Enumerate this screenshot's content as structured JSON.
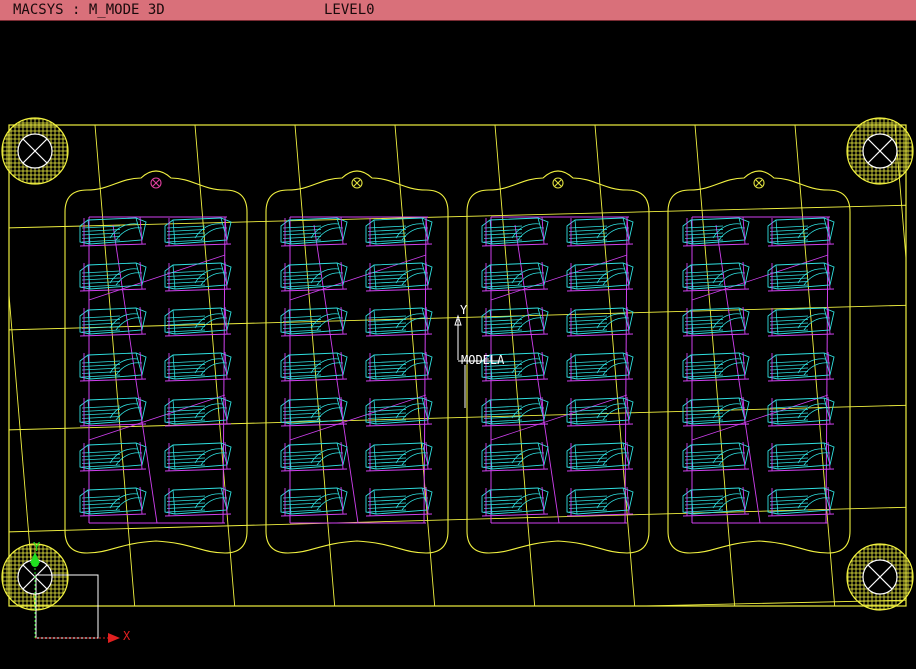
{
  "title_bar": {
    "app_mode": "MACSYS : M_MODE 3D",
    "level": "LEVEL0"
  },
  "viewport": {
    "model_axis": {
      "y_label": "Y",
      "name_label": "MODELA"
    },
    "world_axis": {
      "x_label": "X",
      "y_label": "Y"
    },
    "mold_plate": {
      "cavity_panels": 4,
      "parts_per_panel_rows": 7,
      "parts_per_panel_cols": 2,
      "corner_fixtures": 4
    },
    "colors": {
      "outline": "#f0f040",
      "part_wire": "#30e0e0",
      "part_edge": "#d040f0",
      "tab_marker_first": "#e040a0",
      "tab_marker_other": "#e0e040",
      "axis_x": "#e02020",
      "axis_y": "#20e020",
      "axis_box": "#ffffff"
    }
  }
}
